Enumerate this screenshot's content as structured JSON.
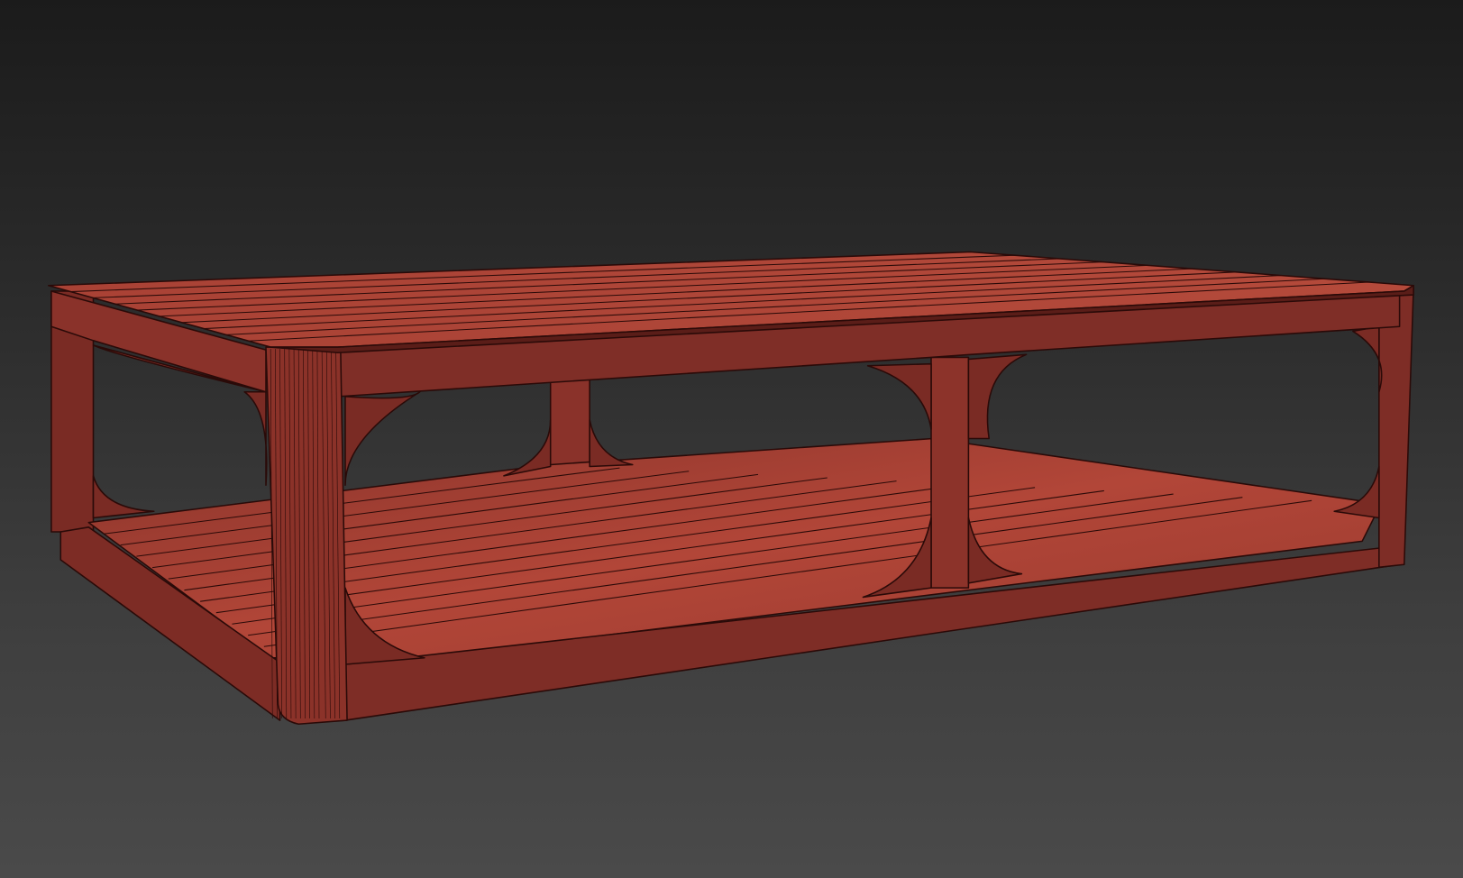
{
  "scene": {
    "object": "coffee-table-wireframe",
    "colors": {
      "background_top": "#1b1b1b",
      "background_bottom": "#4a4a4a",
      "wood_light": "#b5483a",
      "wood_mid": "#8e332a",
      "wood_dark": "#6e2620",
      "edge": "#2a0a08"
    }
  }
}
